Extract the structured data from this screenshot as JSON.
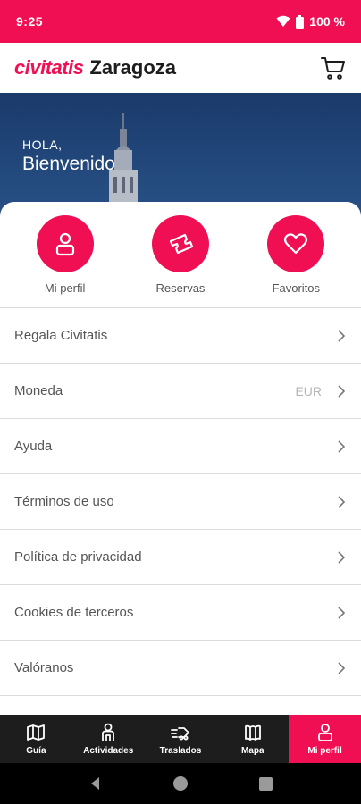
{
  "status_bar": {
    "time": "9:25",
    "battery": "100 %"
  },
  "header": {
    "brand": "civitatis",
    "city": "Zaragoza"
  },
  "hero": {
    "greeting": "HOLA,",
    "welcome": "Bienvenido"
  },
  "quick_actions": [
    {
      "label": "Mi perfil",
      "icon": "user-icon"
    },
    {
      "label": "Reservas",
      "icon": "ticket-icon"
    },
    {
      "label": "Favoritos",
      "icon": "heart-icon"
    }
  ],
  "menu": [
    {
      "label": "Regala Civitatis"
    },
    {
      "label": "Moneda",
      "value": "EUR"
    },
    {
      "label": "Ayuda"
    },
    {
      "label": "Términos de uso"
    },
    {
      "label": "Política de privacidad"
    },
    {
      "label": "Cookies de terceros"
    },
    {
      "label": "Valóranos"
    }
  ],
  "bottom_nav": [
    {
      "label": "Guía",
      "icon": "map-book-icon"
    },
    {
      "label": "Actividades",
      "icon": "person-icon"
    },
    {
      "label": "Traslados",
      "icon": "transfer-icon"
    },
    {
      "label": "Mapa",
      "icon": "map-icon"
    },
    {
      "label": "Mi perfil",
      "icon": "user-icon",
      "active": true
    }
  ],
  "colors": {
    "accent": "#ef0f52",
    "nav_bg": "#1d1d1d",
    "hero_bg": "#1f4273"
  }
}
